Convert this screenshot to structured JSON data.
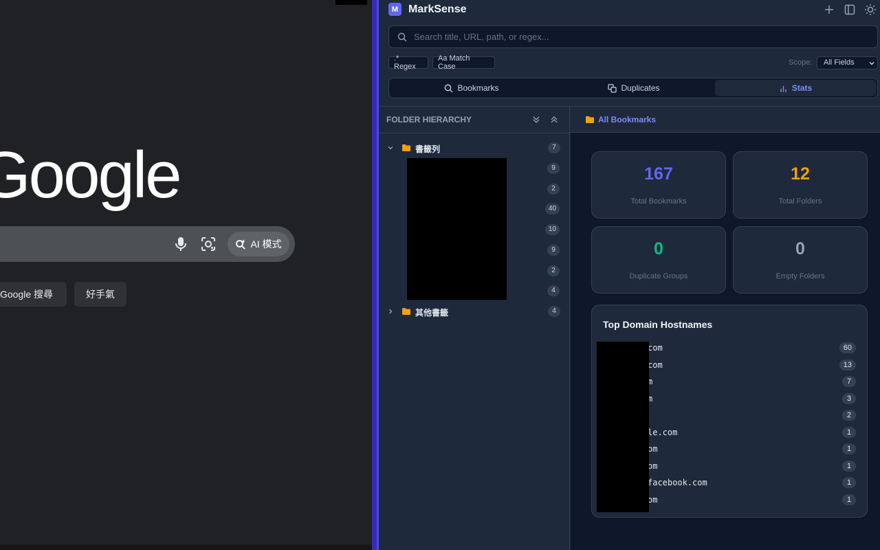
{
  "google": {
    "logo": "Google",
    "ai_mode_label": "AI 模式",
    "search_button": "Google 搜尋",
    "lucky_button": "好手氣"
  },
  "app": {
    "badge": "M",
    "title": "MarkSense"
  },
  "search": {
    "placeholder": "Search title, URL, path, or regex..."
  },
  "filters": {
    "regex_label": ".* Regex",
    "match_case_label": "Aa Match Case",
    "scope_label": "Scope:",
    "scope_value": "All Fields"
  },
  "tabs": [
    {
      "label": "Bookmarks"
    },
    {
      "label": "Duplicates"
    },
    {
      "label": "Stats"
    }
  ],
  "tree": {
    "title": "FOLDER HIERARCHY",
    "root": {
      "label": "書籤列",
      "count": "7"
    },
    "sub_counts": [
      "9",
      "2",
      "40",
      "10",
      "9",
      "2",
      "4"
    ],
    "other": {
      "label": "其他書籤",
      "count": "4"
    }
  },
  "breadcrumb": "All Bookmarks",
  "stats": {
    "total_bookmarks": {
      "value": "167",
      "label": "Total Bookmarks"
    },
    "total_folders": {
      "value": "12",
      "label": "Total Folders"
    },
    "duplicate_groups": {
      "value": "0",
      "label": "Duplicate Groups"
    },
    "empty_folders": {
      "value": "0",
      "label": "Empty Folders"
    }
  },
  "colors": {
    "accent": "#818cf8",
    "total_bookmarks": "#6366f1",
    "total_folders": "#f59e0b",
    "duplicate_groups": "#10b981",
    "empty_folders": "#94a3b8"
  },
  "domains": {
    "title": "Top Domain Hostnames",
    "items": [
      {
        "name": "com",
        "count": "60"
      },
      {
        "name": "com",
        "count": "13"
      },
      {
        "name": "m",
        "count": "7"
      },
      {
        "name": "m",
        "count": "3"
      },
      {
        "name": "",
        "count": "2"
      },
      {
        "name": "le.com",
        "count": "1"
      },
      {
        "name": "om",
        "count": "1"
      },
      {
        "name": "om",
        "count": "1"
      },
      {
        "name": "facebook.com",
        "count": "1"
      },
      {
        "name": "om",
        "count": "1"
      }
    ]
  }
}
